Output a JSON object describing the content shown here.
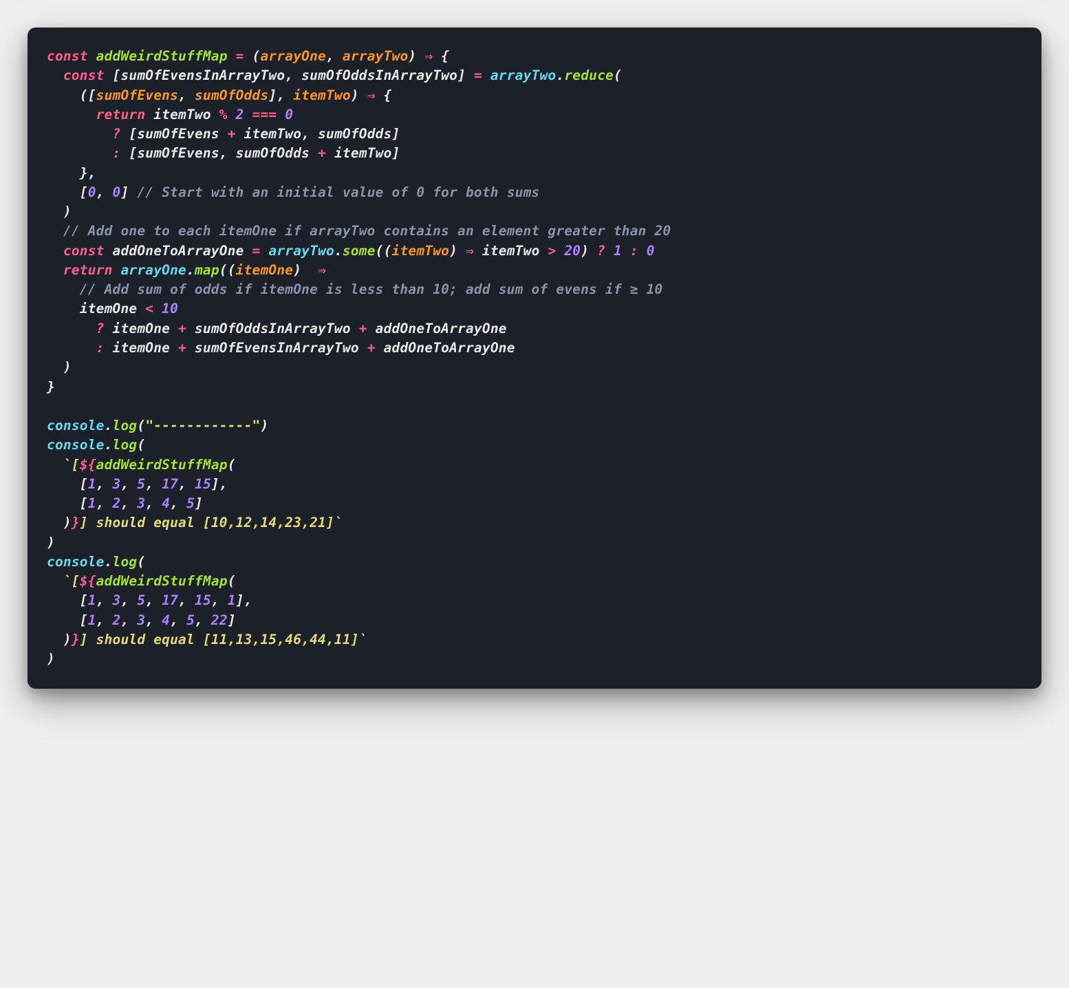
{
  "code": {
    "lines": [
      [
        {
          "t": "const ",
          "c": "c-keyword"
        },
        {
          "t": "addWeirdStuffMap",
          "c": "c-func"
        },
        {
          "t": " = ",
          "c": "c-op"
        },
        {
          "t": "(",
          "c": "c-punct"
        },
        {
          "t": "arrayOne",
          "c": "c-param"
        },
        {
          "t": ", ",
          "c": "c-punct"
        },
        {
          "t": "arrayTwo",
          "c": "c-param"
        },
        {
          "t": ") ",
          "c": "c-punct"
        },
        {
          "t": "⇒",
          "c": "c-op"
        },
        {
          "t": " {",
          "c": "c-punct"
        }
      ],
      [
        {
          "t": "  const ",
          "c": "c-keyword"
        },
        {
          "t": "[",
          "c": "c-punct"
        },
        {
          "t": "sumOfEvensInArrayTwo",
          "c": "c-ident"
        },
        {
          "t": ", ",
          "c": "c-punct"
        },
        {
          "t": "sumOfOddsInArrayTwo",
          "c": "c-ident"
        },
        {
          "t": "] ",
          "c": "c-punct"
        },
        {
          "t": "= ",
          "c": "c-op"
        },
        {
          "t": "arrayTwo",
          "c": "c-blue"
        },
        {
          "t": ".",
          "c": "c-punct"
        },
        {
          "t": "reduce",
          "c": "c-func"
        },
        {
          "t": "(",
          "c": "c-punct"
        }
      ],
      [
        {
          "t": "    ([",
          "c": "c-punct"
        },
        {
          "t": "sumOfEvens",
          "c": "c-param"
        },
        {
          "t": ", ",
          "c": "c-punct"
        },
        {
          "t": "sumOfOdds",
          "c": "c-param"
        },
        {
          "t": "], ",
          "c": "c-punct"
        },
        {
          "t": "itemTwo",
          "c": "c-param"
        },
        {
          "t": ") ",
          "c": "c-punct"
        },
        {
          "t": "⇒",
          "c": "c-op"
        },
        {
          "t": " {",
          "c": "c-punct"
        }
      ],
      [
        {
          "t": "      return ",
          "c": "c-keyword"
        },
        {
          "t": "itemTwo",
          "c": "c-ident"
        },
        {
          "t": " % ",
          "c": "c-op"
        },
        {
          "t": "2",
          "c": "c-num"
        },
        {
          "t": " === ",
          "c": "c-op"
        },
        {
          "t": "0",
          "c": "c-num"
        }
      ],
      [
        {
          "t": "        ? ",
          "c": "c-op"
        },
        {
          "t": "[",
          "c": "c-punct"
        },
        {
          "t": "sumOfEvens",
          "c": "c-ident"
        },
        {
          "t": " + ",
          "c": "c-op"
        },
        {
          "t": "itemTwo",
          "c": "c-ident"
        },
        {
          "t": ", ",
          "c": "c-punct"
        },
        {
          "t": "sumOfOdds",
          "c": "c-ident"
        },
        {
          "t": "]",
          "c": "c-punct"
        }
      ],
      [
        {
          "t": "        : ",
          "c": "c-op"
        },
        {
          "t": "[",
          "c": "c-punct"
        },
        {
          "t": "sumOfEvens",
          "c": "c-ident"
        },
        {
          "t": ", ",
          "c": "c-punct"
        },
        {
          "t": "sumOfOdds",
          "c": "c-ident"
        },
        {
          "t": " + ",
          "c": "c-op"
        },
        {
          "t": "itemTwo",
          "c": "c-ident"
        },
        {
          "t": "]",
          "c": "c-punct"
        }
      ],
      [
        {
          "t": "    },",
          "c": "c-punct"
        }
      ],
      [
        {
          "t": "    [",
          "c": "c-punct"
        },
        {
          "t": "0",
          "c": "c-num"
        },
        {
          "t": ", ",
          "c": "c-punct"
        },
        {
          "t": "0",
          "c": "c-num"
        },
        {
          "t": "] ",
          "c": "c-punct"
        },
        {
          "t": "// Start with an initial value of 0 for both sums",
          "c": "c-comment"
        }
      ],
      [
        {
          "t": "  )",
          "c": "c-punct"
        }
      ],
      [
        {
          "t": "  // Add one to each itemOne if arrayTwo contains an element greater than 20",
          "c": "c-comment"
        }
      ],
      [
        {
          "t": "  const ",
          "c": "c-keyword"
        },
        {
          "t": "addOneToArrayOne",
          "c": "c-ident"
        },
        {
          "t": " = ",
          "c": "c-op"
        },
        {
          "t": "arrayTwo",
          "c": "c-blue"
        },
        {
          "t": ".",
          "c": "c-punct"
        },
        {
          "t": "some",
          "c": "c-func"
        },
        {
          "t": "((",
          "c": "c-punct"
        },
        {
          "t": "itemTwo",
          "c": "c-param"
        },
        {
          "t": ") ",
          "c": "c-punct"
        },
        {
          "t": "⇒",
          "c": "c-op"
        },
        {
          "t": " itemTwo",
          "c": "c-ident"
        },
        {
          "t": " > ",
          "c": "c-op"
        },
        {
          "t": "20",
          "c": "c-num"
        },
        {
          "t": ") ",
          "c": "c-punct"
        },
        {
          "t": "?",
          "c": "c-op"
        },
        {
          "t": " 1 ",
          "c": "c-num"
        },
        {
          "t": ":",
          "c": "c-op"
        },
        {
          "t": " 0",
          "c": "c-num"
        }
      ],
      [
        {
          "t": "  return ",
          "c": "c-keyword"
        },
        {
          "t": "arrayOne",
          "c": "c-blue"
        },
        {
          "t": ".",
          "c": "c-punct"
        },
        {
          "t": "map",
          "c": "c-func"
        },
        {
          "t": "((",
          "c": "c-punct"
        },
        {
          "t": "itemOne",
          "c": "c-param"
        },
        {
          "t": ") ",
          "c": "c-punct"
        },
        {
          "t": " ⇒",
          "c": "c-op"
        }
      ],
      [
        {
          "t": "    // Add sum of odds if itemOne is less than 10; add sum of evens if ≥ 10",
          "c": "c-comment"
        }
      ],
      [
        {
          "t": "    itemOne",
          "c": "c-ident"
        },
        {
          "t": " < ",
          "c": "c-op"
        },
        {
          "t": "10",
          "c": "c-num"
        }
      ],
      [
        {
          "t": "      ? ",
          "c": "c-op"
        },
        {
          "t": "itemOne",
          "c": "c-ident"
        },
        {
          "t": " + ",
          "c": "c-op"
        },
        {
          "t": "sumOfOddsInArrayTwo",
          "c": "c-ident"
        },
        {
          "t": " + ",
          "c": "c-op"
        },
        {
          "t": "addOneToArrayOne",
          "c": "c-ident"
        }
      ],
      [
        {
          "t": "      : ",
          "c": "c-op"
        },
        {
          "t": "itemOne",
          "c": "c-ident"
        },
        {
          "t": " + ",
          "c": "c-op"
        },
        {
          "t": "sumOfEvensInArrayTwo",
          "c": "c-ident"
        },
        {
          "t": " + ",
          "c": "c-op"
        },
        {
          "t": "addOneToArrayOne",
          "c": "c-ident"
        }
      ],
      [
        {
          "t": "  )",
          "c": "c-punct"
        }
      ],
      [
        {
          "t": "}",
          "c": "c-punct"
        }
      ],
      [
        {
          "t": " ",
          "c": "c-punct"
        }
      ],
      [
        {
          "t": "console",
          "c": "c-blue"
        },
        {
          "t": ".",
          "c": "c-punct"
        },
        {
          "t": "log",
          "c": "c-func"
        },
        {
          "t": "(",
          "c": "c-punct"
        },
        {
          "t": "\"------------\"",
          "c": "c-str"
        },
        {
          "t": ")",
          "c": "c-punct"
        }
      ],
      [
        {
          "t": "console",
          "c": "c-blue"
        },
        {
          "t": ".",
          "c": "c-punct"
        },
        {
          "t": "log",
          "c": "c-func"
        },
        {
          "t": "(",
          "c": "c-punct"
        }
      ],
      [
        {
          "t": "  `[",
          "c": "c-str"
        },
        {
          "t": "${",
          "c": "c-op"
        },
        {
          "t": "addWeirdStuffMap",
          "c": "c-func"
        },
        {
          "t": "(",
          "c": "c-punct"
        }
      ],
      [
        {
          "t": "    [",
          "c": "c-punct"
        },
        {
          "t": "1",
          "c": "c-num"
        },
        {
          "t": ", ",
          "c": "c-punct"
        },
        {
          "t": "3",
          "c": "c-num"
        },
        {
          "t": ", ",
          "c": "c-punct"
        },
        {
          "t": "5",
          "c": "c-num"
        },
        {
          "t": ", ",
          "c": "c-punct"
        },
        {
          "t": "17",
          "c": "c-num"
        },
        {
          "t": ", ",
          "c": "c-punct"
        },
        {
          "t": "15",
          "c": "c-num"
        },
        {
          "t": "],",
          "c": "c-punct"
        }
      ],
      [
        {
          "t": "    [",
          "c": "c-punct"
        },
        {
          "t": "1",
          "c": "c-num"
        },
        {
          "t": ", ",
          "c": "c-punct"
        },
        {
          "t": "2",
          "c": "c-num"
        },
        {
          "t": ", ",
          "c": "c-punct"
        },
        {
          "t": "3",
          "c": "c-num"
        },
        {
          "t": ", ",
          "c": "c-punct"
        },
        {
          "t": "4",
          "c": "c-num"
        },
        {
          "t": ", ",
          "c": "c-punct"
        },
        {
          "t": "5",
          "c": "c-num"
        },
        {
          "t": "]",
          "c": "c-punct"
        }
      ],
      [
        {
          "t": "  )",
          "c": "c-punct"
        },
        {
          "t": "}",
          "c": "c-op"
        },
        {
          "t": "] should equal [10,12,14,23,21]`",
          "c": "c-str"
        }
      ],
      [
        {
          "t": ")",
          "c": "c-punct"
        }
      ],
      [
        {
          "t": "console",
          "c": "c-blue"
        },
        {
          "t": ".",
          "c": "c-punct"
        },
        {
          "t": "log",
          "c": "c-func"
        },
        {
          "t": "(",
          "c": "c-punct"
        }
      ],
      [
        {
          "t": "  `[",
          "c": "c-str"
        },
        {
          "t": "${",
          "c": "c-op"
        },
        {
          "t": "addWeirdStuffMap",
          "c": "c-func"
        },
        {
          "t": "(",
          "c": "c-punct"
        }
      ],
      [
        {
          "t": "    [",
          "c": "c-punct"
        },
        {
          "t": "1",
          "c": "c-num"
        },
        {
          "t": ", ",
          "c": "c-punct"
        },
        {
          "t": "3",
          "c": "c-num"
        },
        {
          "t": ", ",
          "c": "c-punct"
        },
        {
          "t": "5",
          "c": "c-num"
        },
        {
          "t": ", ",
          "c": "c-punct"
        },
        {
          "t": "17",
          "c": "c-num"
        },
        {
          "t": ", ",
          "c": "c-punct"
        },
        {
          "t": "15",
          "c": "c-num"
        },
        {
          "t": ", ",
          "c": "c-punct"
        },
        {
          "t": "1",
          "c": "c-num"
        },
        {
          "t": "],",
          "c": "c-punct"
        }
      ],
      [
        {
          "t": "    [",
          "c": "c-punct"
        },
        {
          "t": "1",
          "c": "c-num"
        },
        {
          "t": ", ",
          "c": "c-punct"
        },
        {
          "t": "2",
          "c": "c-num"
        },
        {
          "t": ", ",
          "c": "c-punct"
        },
        {
          "t": "3",
          "c": "c-num"
        },
        {
          "t": ", ",
          "c": "c-punct"
        },
        {
          "t": "4",
          "c": "c-num"
        },
        {
          "t": ", ",
          "c": "c-punct"
        },
        {
          "t": "5",
          "c": "c-num"
        },
        {
          "t": ", ",
          "c": "c-punct"
        },
        {
          "t": "22",
          "c": "c-num"
        },
        {
          "t": "]",
          "c": "c-punct"
        }
      ],
      [
        {
          "t": "  )",
          "c": "c-punct"
        },
        {
          "t": "}",
          "c": "c-op"
        },
        {
          "t": "] should equal [11,13,15,46,44,11]`",
          "c": "c-str"
        }
      ],
      [
        {
          "t": ")",
          "c": "c-punct"
        }
      ]
    ]
  }
}
